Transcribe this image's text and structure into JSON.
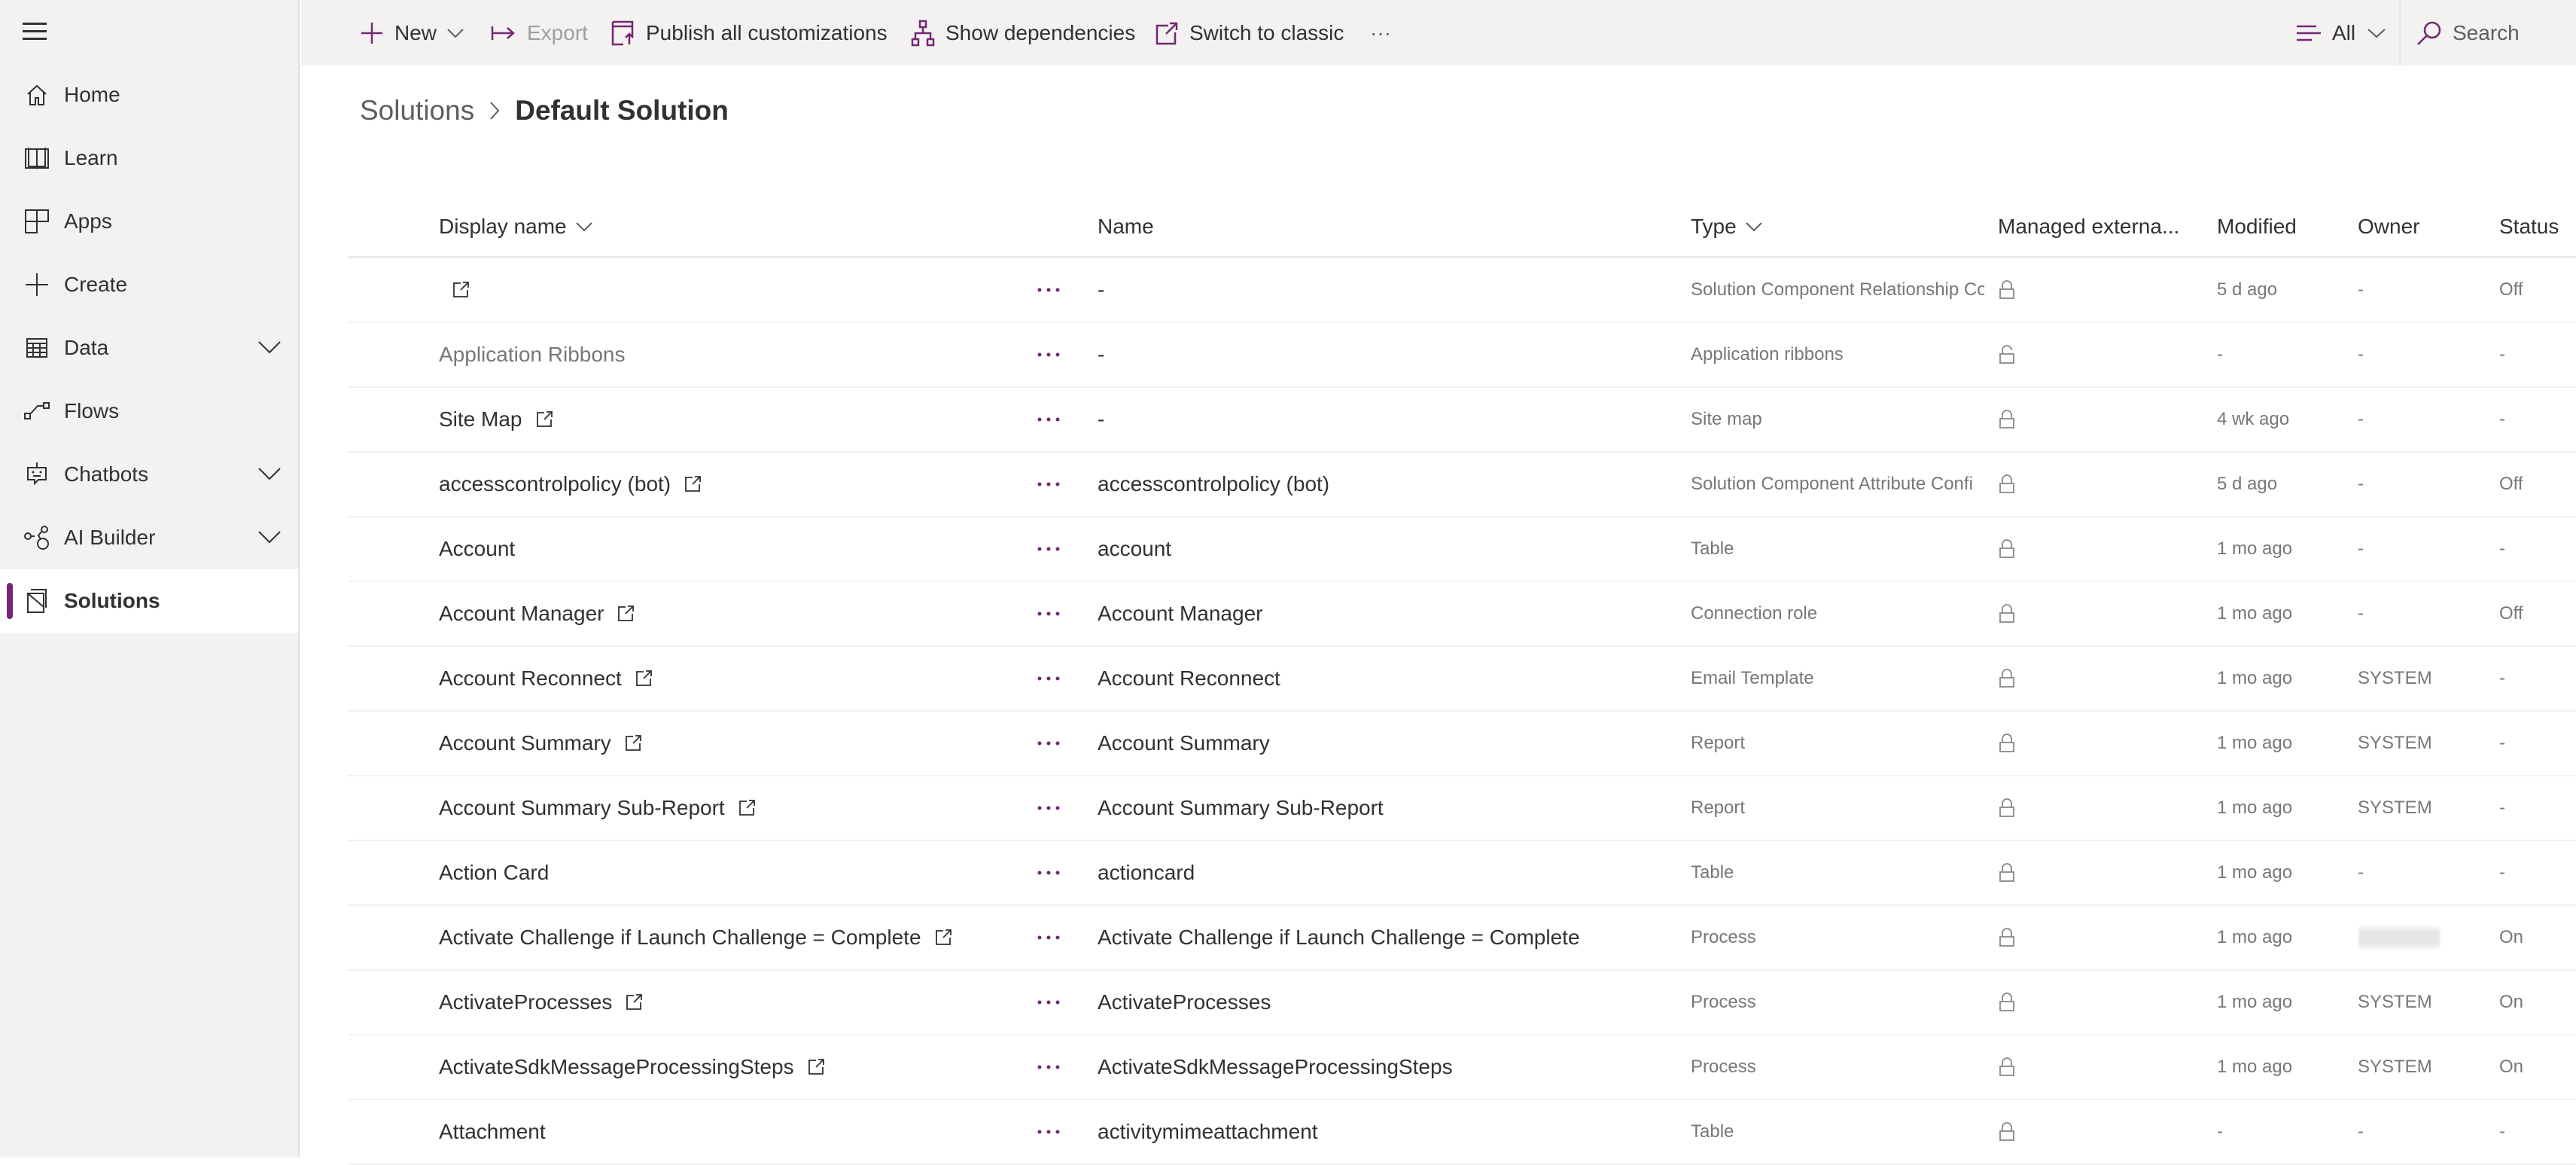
{
  "colors": {
    "accent": "#742774",
    "sidebar_bg": "#f3f2f1",
    "text_primary": "#323130",
    "text_secondary": "#797775"
  },
  "sidebar": {
    "menu_icon": "hamburger-icon",
    "items": [
      {
        "label": "Home",
        "icon": "home-icon",
        "expandable": false,
        "active": false
      },
      {
        "label": "Learn",
        "icon": "book-icon",
        "expandable": false,
        "active": false
      },
      {
        "label": "Apps",
        "icon": "apps-icon",
        "expandable": false,
        "active": false
      },
      {
        "label": "Create",
        "icon": "plus-icon",
        "expandable": false,
        "active": false
      },
      {
        "label": "Data",
        "icon": "table-icon",
        "expandable": true,
        "active": false
      },
      {
        "label": "Flows",
        "icon": "flow-icon",
        "expandable": false,
        "active": false
      },
      {
        "label": "Chatbots",
        "icon": "bot-icon",
        "expandable": true,
        "active": false
      },
      {
        "label": "AI Builder",
        "icon": "ai-builder-icon",
        "expandable": true,
        "active": false
      },
      {
        "label": "Solutions",
        "icon": "solutions-icon",
        "expandable": false,
        "active": true
      }
    ]
  },
  "toolbar": {
    "new_label": "New",
    "export_label": "Export",
    "publish_label": "Publish all customizations",
    "dependencies_label": "Show dependencies",
    "classic_label": "Switch to classic",
    "more_label": "···",
    "filter_label": "All",
    "search_label": "Search"
  },
  "breadcrumb": {
    "root": "Solutions",
    "current": "Default Solution"
  },
  "table": {
    "columns": {
      "display_name": "Display name",
      "name": "Name",
      "type": "Type",
      "managed": "Managed externa...",
      "modified": "Modified",
      "owner": "Owner",
      "status": "Status"
    },
    "rows": [
      {
        "display_name": "",
        "external_link": true,
        "muted": false,
        "name": "-",
        "type": "Solution Component Relationship Co",
        "locked": true,
        "modified": "5 d ago",
        "owner": "-",
        "owner_redacted": false,
        "status": "Off"
      },
      {
        "display_name": "Application Ribbons",
        "external_link": false,
        "muted": true,
        "name": "-",
        "type": "Application ribbons",
        "locked": false,
        "modified": "-",
        "owner": "-",
        "owner_redacted": false,
        "status": "-"
      },
      {
        "display_name": "Site Map",
        "external_link": true,
        "muted": false,
        "name": "-",
        "type": "Site map",
        "locked": true,
        "modified": "4 wk ago",
        "owner": "-",
        "owner_redacted": false,
        "status": "-"
      },
      {
        "display_name": "accesscontrolpolicy (bot)",
        "external_link": true,
        "muted": false,
        "name": "accesscontrolpolicy (bot)",
        "type": "Solution Component Attribute Confi",
        "locked": true,
        "modified": "5 d ago",
        "owner": "-",
        "owner_redacted": false,
        "status": "Off"
      },
      {
        "display_name": "Account",
        "external_link": false,
        "muted": false,
        "name": "account",
        "type": "Table",
        "locked": true,
        "modified": "1 mo ago",
        "owner": "-",
        "owner_redacted": false,
        "status": "-"
      },
      {
        "display_name": "Account Manager",
        "external_link": true,
        "muted": false,
        "name": "Account Manager",
        "type": "Connection role",
        "locked": true,
        "modified": "1 mo ago",
        "owner": "-",
        "owner_redacted": false,
        "status": "Off"
      },
      {
        "display_name": "Account Reconnect",
        "external_link": true,
        "muted": false,
        "name": "Account Reconnect",
        "type": "Email Template",
        "locked": true,
        "modified": "1 mo ago",
        "owner": "SYSTEM",
        "owner_redacted": false,
        "status": "-"
      },
      {
        "display_name": "Account Summary",
        "external_link": true,
        "muted": false,
        "name": "Account Summary",
        "type": "Report",
        "locked": true,
        "modified": "1 mo ago",
        "owner": "SYSTEM",
        "owner_redacted": false,
        "status": "-"
      },
      {
        "display_name": "Account Summary Sub-Report",
        "external_link": true,
        "muted": false,
        "name": "Account Summary Sub-Report",
        "type": "Report",
        "locked": true,
        "modified": "1 mo ago",
        "owner": "SYSTEM",
        "owner_redacted": false,
        "status": "-"
      },
      {
        "display_name": "Action Card",
        "external_link": false,
        "muted": false,
        "name": "actioncard",
        "type": "Table",
        "locked": true,
        "modified": "1 mo ago",
        "owner": "-",
        "owner_redacted": false,
        "status": "-"
      },
      {
        "display_name": "Activate Challenge if Launch Challenge = Complete",
        "external_link": true,
        "muted": false,
        "name": "Activate Challenge if Launch Challenge = Complete",
        "type": "Process",
        "locked": true,
        "modified": "1 mo ago",
        "owner": "",
        "owner_redacted": true,
        "status": "On"
      },
      {
        "display_name": "ActivateProcesses",
        "external_link": true,
        "muted": false,
        "name": "ActivateProcesses",
        "type": "Process",
        "locked": true,
        "modified": "1 mo ago",
        "owner": "SYSTEM",
        "owner_redacted": false,
        "status": "On"
      },
      {
        "display_name": "ActivateSdkMessageProcessingSteps",
        "external_link": true,
        "muted": false,
        "name": "ActivateSdkMessageProcessingSteps",
        "type": "Process",
        "locked": true,
        "modified": "1 mo ago",
        "owner": "SYSTEM",
        "owner_redacted": false,
        "status": "On"
      },
      {
        "display_name": "Attachment",
        "external_link": false,
        "muted": false,
        "name": "activitymimeattachment",
        "type": "Table",
        "locked": true,
        "modified": "-",
        "owner": "-",
        "owner_redacted": false,
        "status": "-"
      }
    ]
  }
}
